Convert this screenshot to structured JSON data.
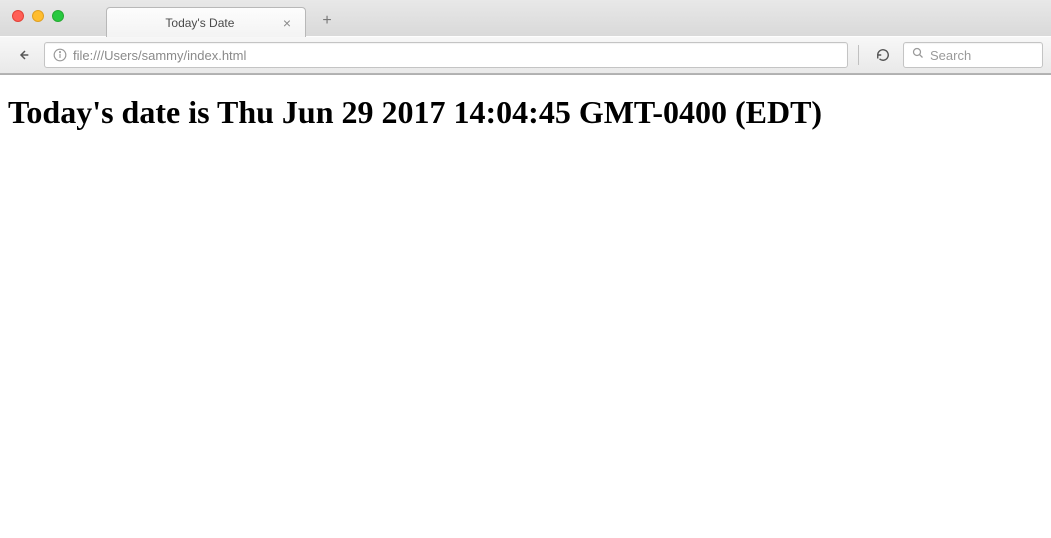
{
  "window": {
    "tab_title": "Today's Date",
    "new_tab_glyph": "+",
    "close_glyph": "×"
  },
  "toolbar": {
    "url": "file:///Users/sammy/index.html",
    "search_placeholder": "Search"
  },
  "page": {
    "heading": "Today's date is Thu Jun 29 2017 14:04:45 GMT-0400 (EDT)"
  }
}
